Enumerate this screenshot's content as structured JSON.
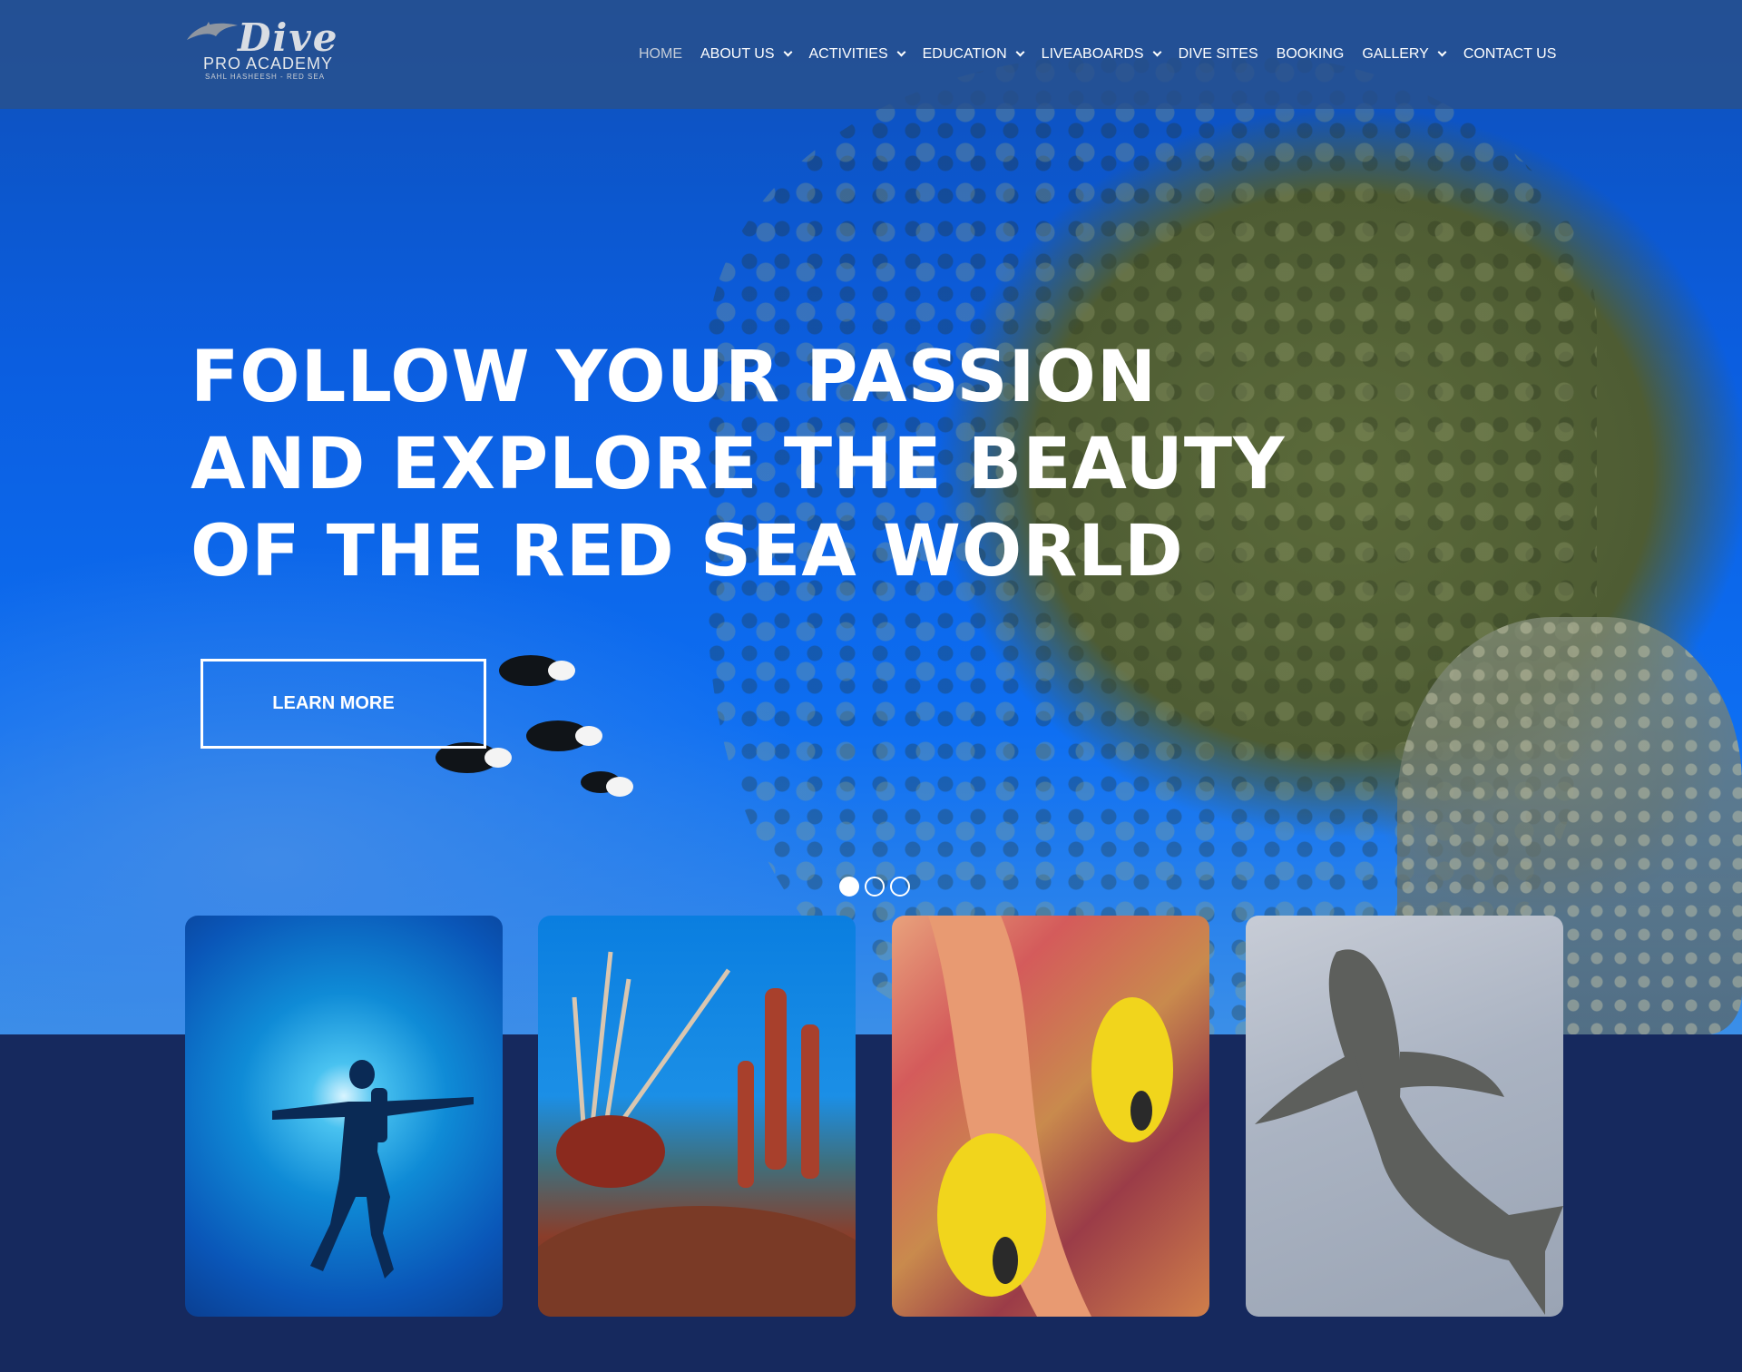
{
  "brand": {
    "logo_word": "Dive",
    "logo_sub": "PRO ACADEMY",
    "logo_tag": "SAHL HASHEESH - RED SEA"
  },
  "nav": {
    "items": [
      {
        "label": "HOME",
        "active": true,
        "dropdown": false
      },
      {
        "label": "ABOUT US",
        "active": false,
        "dropdown": true
      },
      {
        "label": "ACTIVITIES",
        "active": false,
        "dropdown": true
      },
      {
        "label": "EDUCATION",
        "active": false,
        "dropdown": true
      },
      {
        "label": "LIVEABOARDS",
        "active": false,
        "dropdown": true
      },
      {
        "label": "DIVE SITES",
        "active": false,
        "dropdown": false
      },
      {
        "label": "BOOKING",
        "active": false,
        "dropdown": false
      },
      {
        "label": "GALLERY",
        "active": false,
        "dropdown": true
      },
      {
        "label": "CONTACT US",
        "active": false,
        "dropdown": false
      }
    ]
  },
  "hero": {
    "title_lines": [
      "FOLLOW YOUR PASSION",
      "AND EXPLORE THE BEAUTY",
      "OF THE RED SEA WORLD"
    ],
    "cta_label": "LEARN MORE",
    "slides_total": 3,
    "slide_active": 1
  },
  "cards": [
    {
      "icon": "diver-photo"
    },
    {
      "icon": "lionfish-photo"
    },
    {
      "icon": "butterflyfish-photo"
    },
    {
      "icon": "shark-photo"
    }
  ],
  "colors": {
    "header_bg": "#28508c",
    "band_bg": "#16295e",
    "text": "#ffffff",
    "nav_active": "#c4ccd8"
  }
}
